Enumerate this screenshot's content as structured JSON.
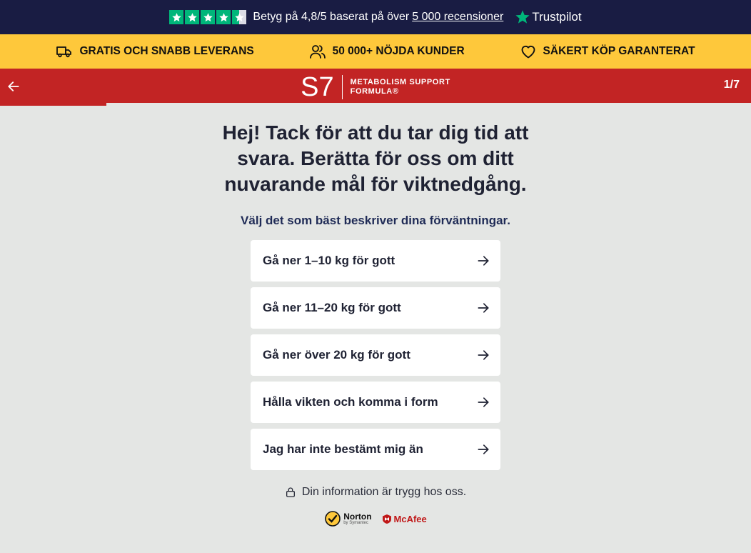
{
  "colors": {
    "topbar": "#191c43",
    "benefits": "#fec83b",
    "navbar": "#c22424",
    "trustpilot_green": "#00b67a",
    "page_bg": "#e4e6e4"
  },
  "trustbar": {
    "stars": 4.5,
    "rating_text": "Betyg på 4,8/5 baserat på över",
    "reviews_link": "5 000 recensioner",
    "brand": "Trustpilot",
    "brand_icon": "trustpilot-star-icon"
  },
  "benefits": [
    {
      "icon": "truck-icon",
      "label": "GRATIS OCH SNABB LEVERANS"
    },
    {
      "icon": "users-icon",
      "label": "50 000+ NÖJDA KUNDER"
    },
    {
      "icon": "heart-icon",
      "label": "SÄKERT KÖP GARANTERAT"
    }
  ],
  "nav": {
    "back_icon": "arrow-left-icon",
    "logo_mark": "S7",
    "logo_line1": "METABOLISM SUPPORT",
    "logo_line2": "FORMULA®",
    "step": "1/7",
    "progress": 0.142
  },
  "main": {
    "title": "Hej! Tack för att du tar dig tid att svara. Berätta för oss om ditt nuvarande mål för viktnedgång.",
    "subtitle": "Välj det som bäst beskriver dina förväntningar.",
    "options": [
      "Gå ner 1–10 kg för gott",
      "Gå ner 11–20 kg för gott",
      "Gå ner över 20 kg för gott",
      "Hålla vikten och komma i form",
      "Jag har inte bestämt mig än"
    ],
    "secure_text": "Din information är trygg hos oss.",
    "secure_icon": "lock-icon"
  },
  "badges": {
    "norton": "Norton",
    "norton_sub": "by Symantec",
    "mcafee": "McAfee"
  }
}
